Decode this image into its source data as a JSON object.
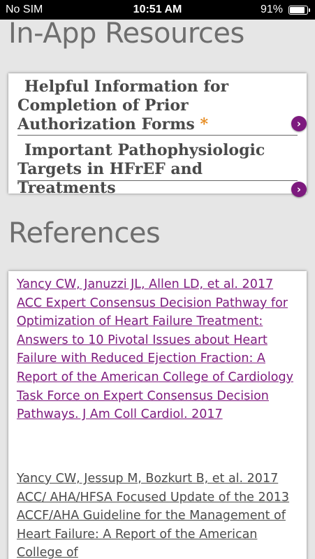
{
  "status_bar": {
    "carrier": "No SIM",
    "time": "10:51 AM",
    "battery_percent": "91%",
    "battery_level": 0.91
  },
  "resources": {
    "title": "In-App Resources",
    "items": [
      {
        "lines": [
          "Helpful Information for",
          "Completion of Prior",
          "Authorization Forms"
        ],
        "asterisk": "*",
        "icon": "chevron-right-circle-icon"
      },
      {
        "lines": [
          "Important Pathophysiologic",
          "Targets in HFrEF and Treatments"
        ],
        "icon": "chevron-right-circle-icon"
      }
    ]
  },
  "references": {
    "title": "References",
    "items": [
      "Yancy CW, Januzzi JL, Allen LD, et al. 2017 ACC Expert Consensus Decision Pathway for Optimization of Heart Failure Treatment: Answers to 10 Pivotal Issues about Heart Failure with Reduced Ejection Fraction: A Report of the American College of Cardiology Task Force on Expert Consensus Decision Pathways. J Am Coll Cardiol. 2017",
      "Yancy CW, Jessup M, Bozkurt B, et al. 2017 ACC/ AHA/HFSA Focused Update of the 2013 ACCF/AHA Guideline for the Management of Heart Failure: A Report of the American College of"
    ]
  },
  "colors": {
    "link_purple": "#7d1a7e",
    "asterisk_orange": "#e68a1e",
    "background": "#e6e6e6"
  }
}
